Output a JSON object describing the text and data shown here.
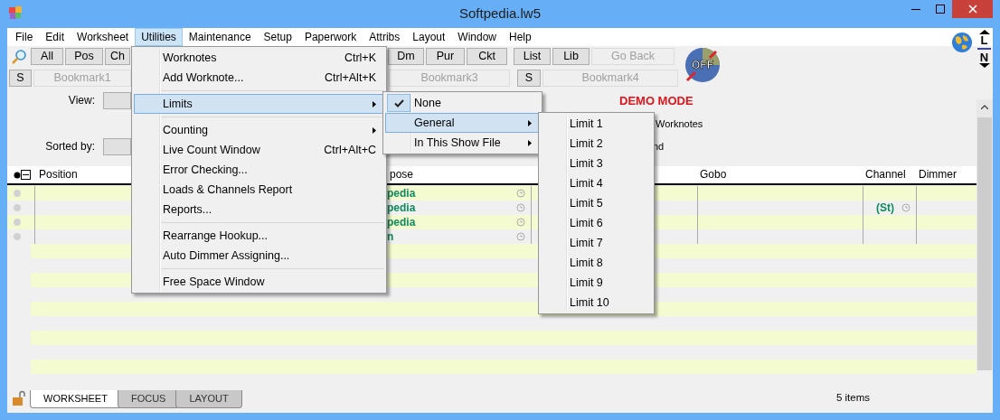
{
  "window": {
    "title": "Softpedia.lw5"
  },
  "menu_bar": [
    {
      "label": "File",
      "selected": false
    },
    {
      "label": "Edit",
      "selected": false
    },
    {
      "label": "Worksheet",
      "selected": false
    },
    {
      "label": "Utilities",
      "selected": true
    },
    {
      "label": "Maintenance",
      "selected": false
    },
    {
      "label": "Setup",
      "selected": false
    },
    {
      "label": "Paperwork",
      "selected": false
    },
    {
      "label": "Attribs",
      "selected": false
    },
    {
      "label": "Layout",
      "selected": false
    },
    {
      "label": "Window",
      "selected": false
    },
    {
      "label": "Help",
      "selected": false
    }
  ],
  "toolbar_row_1": [
    [
      {
        "label": "All",
        "disabled": false
      },
      {
        "label": "Pos",
        "disabled": false
      },
      {
        "label": "Ch",
        "disabled": false
      }
    ],
    [
      {
        "label": "Dm",
        "disabled": false
      },
      {
        "label": "Pur",
        "disabled": false
      },
      {
        "label": "Ckt",
        "disabled": false
      }
    ],
    [
      {
        "label": "List",
        "disabled": false
      },
      {
        "label": "Lib",
        "disabled": false
      },
      {
        "label": "Go Back",
        "disabled": true
      }
    ]
  ],
  "toolbar_row_2": [
    [
      {
        "label": "S",
        "disabled": false
      },
      {
        "label": "Bookmark1",
        "disabled": true
      }
    ],
    [
      {
        "label": "Bookmark3",
        "disabled": true
      }
    ],
    [
      {
        "label": "S",
        "disabled": false
      },
      {
        "label": "Bookmark4",
        "disabled": true
      }
    ]
  ],
  "logo_text": "OFF",
  "nav_buttons": [
    "L",
    "N"
  ],
  "view_label": "View:",
  "sorted_by_label": "Sorted by:",
  "demo_mode": "DEMO MODE",
  "option_fragments": [
    "Worknotes",
    "nd"
  ],
  "table": {
    "columns": [
      "Position",
      "pose",
      "Gobo",
      "Channel",
      "Dimmer"
    ],
    "rows": [
      {
        "column_2": "pedia"
      },
      {
        "column_2": "pedia",
        "channel": "(St)"
      },
      {
        "column_2": "pedia"
      },
      {
        "column_2": "n"
      }
    ]
  },
  "open_menu": {
    "items": [
      {
        "kind": "item",
        "label": "Worknotes",
        "shortcut": "Ctrl+K",
        "selected": false
      },
      {
        "kind": "item",
        "label": "Add Worknote...",
        "shortcut": "Ctrl+Alt+K",
        "selected": false
      },
      {
        "kind": "separator"
      },
      {
        "kind": "submenu",
        "label": "Limits",
        "selected": true
      },
      {
        "kind": "separator"
      },
      {
        "kind": "submenu",
        "label": "Counting",
        "selected": false
      },
      {
        "kind": "item",
        "label": "Live Count Window",
        "shortcut": "Ctrl+Alt+C",
        "selected": false
      },
      {
        "kind": "item",
        "label": "Error Checking...",
        "selected": false
      },
      {
        "kind": "item",
        "label": "Loads & Channels Report",
        "selected": false
      },
      {
        "kind": "item",
        "label": "Reports...",
        "selected": false
      },
      {
        "kind": "separator"
      },
      {
        "kind": "item",
        "label": "Rearrange Hookup...",
        "selected": false
      },
      {
        "kind": "item",
        "label": "Auto Dimmer Assigning...",
        "selected": false
      },
      {
        "kind": "separator"
      },
      {
        "kind": "item",
        "label": "Free Space Window",
        "selected": false
      }
    ]
  },
  "limits_submenu": {
    "items": [
      {
        "kind": "item",
        "label": "None",
        "checked": true,
        "selected": false
      },
      {
        "kind": "submenu",
        "label": "General",
        "checked": false,
        "selected": true
      },
      {
        "kind": "submenu",
        "label": "In This Show File",
        "checked": false,
        "selected": false
      }
    ]
  },
  "general_submenu": {
    "items": [
      {
        "label": "Limit 1",
        "selected": false
      },
      {
        "label": "Limit 2",
        "selected": false
      },
      {
        "label": "Limit 3",
        "selected": false
      },
      {
        "label": "Limit 4",
        "selected": false
      },
      {
        "label": "Limit 5",
        "selected": false
      },
      {
        "label": "Limit 6",
        "selected": false
      },
      {
        "label": "Limit 7",
        "selected": false
      },
      {
        "label": "Limit 8",
        "selected": false
      },
      {
        "label": "Limit 9",
        "selected": false
      },
      {
        "label": "Limit 10",
        "selected": false
      }
    ]
  },
  "bottom_tabs": [
    {
      "label": "WORKSHEET",
      "selected": true
    },
    {
      "label": "FOCUS",
      "selected": false
    },
    {
      "label": "LAYOUT",
      "selected": false
    }
  ],
  "status": "5 items"
}
